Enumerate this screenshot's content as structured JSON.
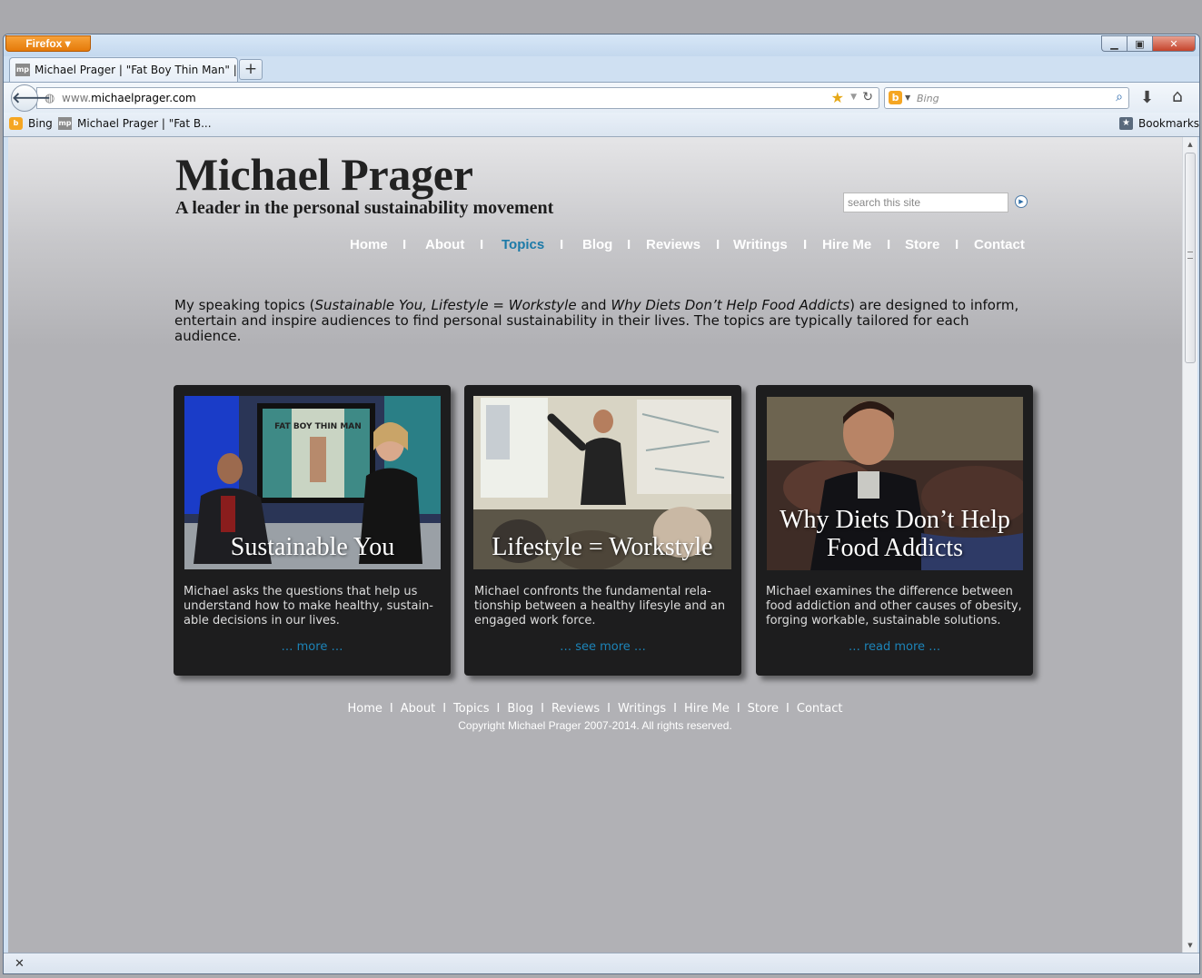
{
  "browser": {
    "menu_button": "Firefox ▾",
    "tab_title": "Michael Prager | \"Fat Boy Thin Man\" | Sp...",
    "url_prefix": "www.",
    "url_domain": "michaelprager.com",
    "search_placeholder": "Bing",
    "bookmarks": [
      "Bing",
      "Michael Prager | \"Fat B..."
    ],
    "bookmarks_menu": "Bookmarks",
    "favicon_text": "mp"
  },
  "site": {
    "title": "Michael Prager",
    "subtitle": "A leader in the personal sustainability movement",
    "search_placeholder": "search this site",
    "nav": [
      "Home",
      "About",
      "Topics",
      "Blog",
      "Reviews",
      "Writings",
      "Hire Me",
      "Store",
      "Contact"
    ],
    "nav_active": "Topics",
    "nav_separator": "I",
    "intro": {
      "p1": "My speaking topics (",
      "t1": "Sustainable You, Lifestyle = Workstyle",
      "p2": " and ",
      "t2": "Why Diets Don’t Help Food Addicts",
      "p3": ") are designed to inform, entertain and inspire audiences to find personal sustainability in their lives. The topics are typically tailored for each audience."
    },
    "cards": [
      {
        "title": "Sustainable You",
        "image_sign": "FAT BOY THIN MAN",
        "description": "Michael asks the questions that help us understand how to make healthy, sustain-able decisions in our lives.",
        "link": "… more …"
      },
      {
        "title": "Lifestyle = Workstyle",
        "description": "Michael confronts the fundamental rela-tionship between a healthy lifesyle and an engaged work force.",
        "link": "… see more …"
      },
      {
        "title_line1": "Why Diets Don’t Help",
        "title_line2": "Food Addicts",
        "description": "Michael examines the difference between food addiction and other causes of obesity, forging workable, sustainable solutions.",
        "link": "… read more …"
      }
    ],
    "footer_nav": [
      "Home",
      "About",
      "Topics",
      "Blog",
      "Reviews",
      "Writings",
      "Hire Me",
      "Store",
      "Contact"
    ],
    "footer_separator": "I",
    "copyright": "Copyright Michael Prager 2007-2014. All rights reserved."
  },
  "colors": {
    "accent": "#1c7aa8",
    "link": "#1d84b8",
    "card_bg": "#1d1d1e",
    "firefox_orange": "#e57a09"
  },
  "icons": {
    "back": "back-arrow-icon",
    "bookmark_star": "star-icon",
    "reload": "reload-icon",
    "download": "download-icon",
    "home": "home-icon",
    "search": "search-icon",
    "close_status": "close-icon"
  }
}
